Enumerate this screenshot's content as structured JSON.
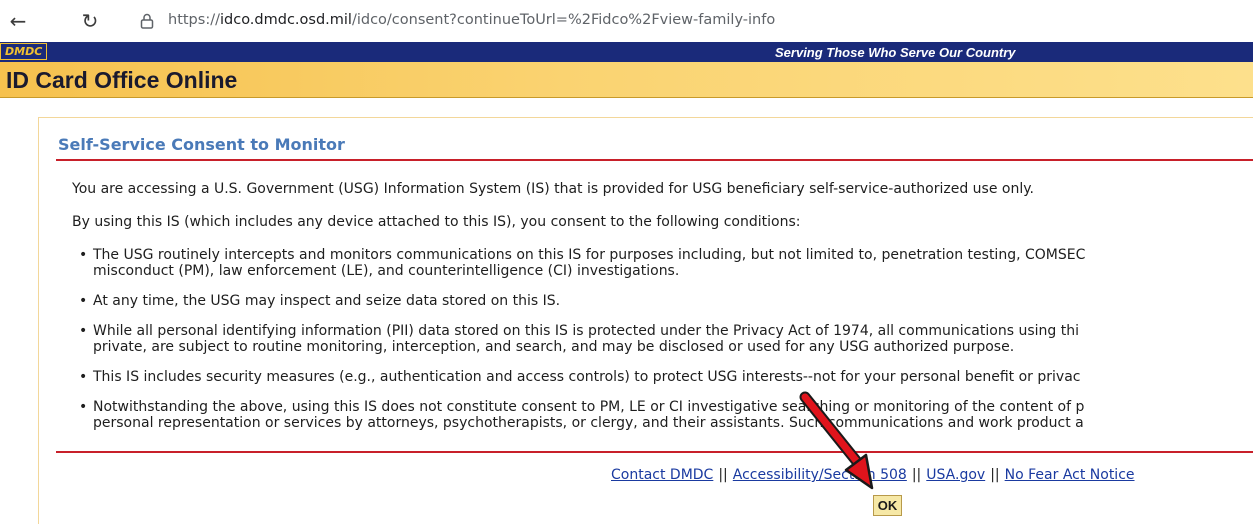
{
  "browser": {
    "url_prefix": "https://",
    "url_host": "idco.dmdc.osd.mil",
    "url_path": "/idco/consent?continueToUrl=%2Fidco%2Fview-family-info"
  },
  "header": {
    "logo": "DMDC",
    "tagline": "Serving Those Who Serve Our Country",
    "site_title": "ID Card Office Online"
  },
  "consent": {
    "title": "Self-Service Consent to Monitor",
    "intro": "You are accessing a U.S. Government (USG) Information System (IS) that is provided for USG beneficiary self-service-authorized use only.",
    "conditions_lead": "By using this IS (which includes any device attached to this IS), you consent to the following conditions:",
    "bullets": [
      {
        "line1": "The USG routinely intercepts and monitors communications on this IS for purposes including, but not limited to, penetration testing, COMSEC",
        "line2": "misconduct (PM), law enforcement (LE), and counterintelligence (CI) investigations."
      },
      {
        "line1": "At any time, the USG may inspect and seize data stored on this IS."
      },
      {
        "line1": "While all personal identifying information (PII) data stored on this IS is protected under the Privacy Act of 1974, all communications using thi",
        "line2": "private, are subject to routine monitoring, interception, and search, and may be disclosed or used for any USG authorized purpose."
      },
      {
        "line1": "This IS includes security measures (e.g., authentication and access controls) to protect USG interests--not for your personal benefit or privac"
      },
      {
        "line1": "Notwithstanding the above, using this IS does not constitute consent to PM, LE or CI investigative searching or monitoring of the content of p",
        "line2": "personal representation or services by attorneys, psychotherapists, or clergy, and their assistants. Such communications and work product a"
      }
    ]
  },
  "footer": {
    "links": [
      "Contact DMDC",
      "Accessibility/Section 508",
      "USA.gov",
      "No Fear Act Notice"
    ],
    "separator": "||",
    "ok_label": "OK"
  },
  "annotation": {
    "arrow_color": "#e0141c"
  }
}
